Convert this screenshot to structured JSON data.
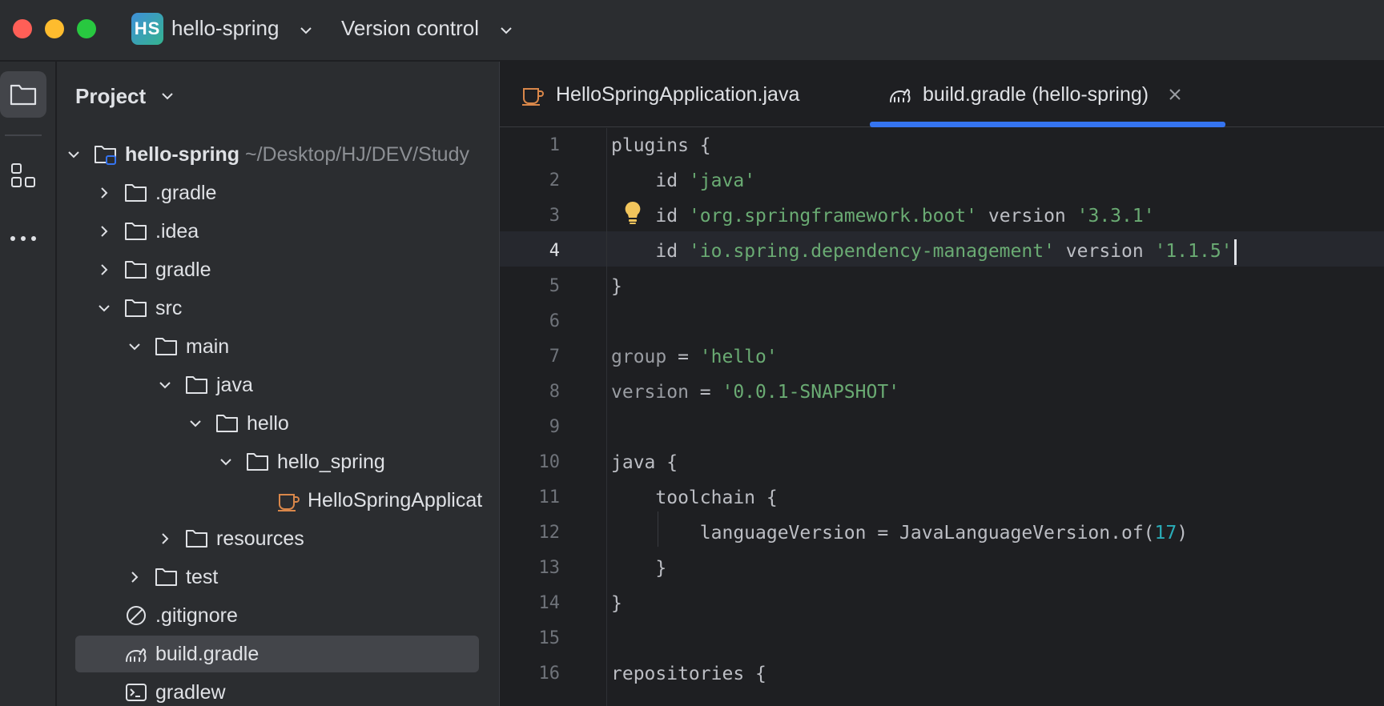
{
  "titlebar": {
    "project_badge": "HS",
    "project_name": "hello-spring",
    "vcs_label": "Version control"
  },
  "activity_bar": {
    "items": [
      "folder-icon",
      "structure-icon",
      "more-icon"
    ]
  },
  "project_panel": {
    "title": "Project",
    "tree": [
      {
        "label": "hello-spring",
        "path": " ~/Desktop/HJ/DEV/Study",
        "icon": "module-folder-icon",
        "expanded": true
      },
      {
        "label": ".gradle",
        "icon": "folder-icon",
        "expanded": false
      },
      {
        "label": ".idea",
        "icon": "folder-icon",
        "expanded": false
      },
      {
        "label": "gradle",
        "icon": "folder-icon",
        "expanded": false
      },
      {
        "label": "src",
        "icon": "folder-icon",
        "expanded": true
      },
      {
        "label": "main",
        "icon": "folder-icon",
        "expanded": true
      },
      {
        "label": "java",
        "icon": "folder-icon",
        "expanded": true
      },
      {
        "label": "hello",
        "icon": "folder-icon",
        "expanded": true
      },
      {
        "label": "hello_spring",
        "icon": "folder-icon",
        "expanded": true
      },
      {
        "label": "HelloSpringApplicat",
        "icon": "java-class-icon"
      },
      {
        "label": "resources",
        "icon": "folder-icon",
        "expanded": false
      },
      {
        "label": "test",
        "icon": "folder-icon",
        "expanded": false
      },
      {
        "label": ".gitignore",
        "icon": "ignore-file-icon"
      },
      {
        "label": "build.gradle",
        "icon": "gradle-icon",
        "selected": true
      },
      {
        "label": "gradlew",
        "icon": "terminal-icon"
      }
    ]
  },
  "editor": {
    "tabs": [
      {
        "label": "HelloSpringApplication.java",
        "icon": "java-class-icon",
        "active": false
      },
      {
        "label": "build.gradle (hello-spring)",
        "icon": "gradle-icon",
        "active": true
      }
    ],
    "current_line": 4,
    "line_numbers": [
      "1",
      "2",
      "3",
      "4",
      "5",
      "6",
      "7",
      "8",
      "9",
      "10",
      "11",
      "12",
      "13",
      "14",
      "15",
      "16"
    ],
    "code": {
      "l1": "plugins {",
      "l2_kw": "id",
      "l2_str": "'java'",
      "l3_kw": "id",
      "l3_str": "'org.springframework.boot'",
      "l3_ver": "version",
      "l3_vstr": "'3.3.1'",
      "l4_kw": "id",
      "l4_str": "'io.spring.dependency-management'",
      "l4_ver": "version",
      "l4_vstr": "'1.1.5'",
      "l5": "}",
      "l7_prop": "group",
      "l7_eq": " = ",
      "l7_str": "'hello'",
      "l8_prop": "version",
      "l8_eq": " = ",
      "l8_str": "'0.0.1-SNAPSHOT'",
      "l10": "java {",
      "l11": "toolchain {",
      "l12_a": "languageVersion = JavaLanguageVersion.of(",
      "l12_num": "17",
      "l12_b": ")",
      "l13": "}",
      "l14": "}",
      "l16": "repositories {"
    }
  }
}
